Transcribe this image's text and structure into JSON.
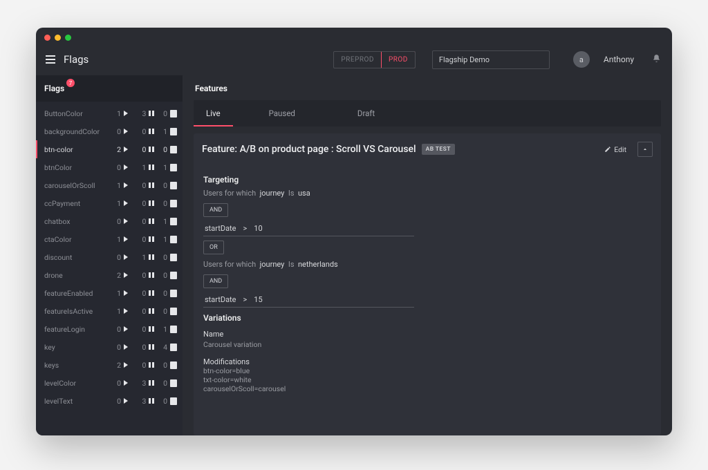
{
  "header": {
    "app_title": "Flags",
    "env_a": "PREPROD",
    "env_b": "PROD",
    "project": "Flagship Demo",
    "avatar_initial": "a",
    "username": "Anthony"
  },
  "sidebar": {
    "title": "Flags",
    "badge": "7",
    "items": [
      {
        "name": "ButtonColor",
        "live": 1,
        "paused": 3,
        "draft": 0,
        "active": false
      },
      {
        "name": "backgroundColor",
        "live": 0,
        "paused": 0,
        "draft": 1,
        "active": false
      },
      {
        "name": "btn-color",
        "live": 2,
        "paused": 0,
        "draft": 0,
        "active": true
      },
      {
        "name": "btnColor",
        "live": 0,
        "paused": 1,
        "draft": 1,
        "active": false
      },
      {
        "name": "carouselOrScoll",
        "live": 1,
        "paused": 0,
        "draft": 0,
        "active": false
      },
      {
        "name": "ccPayment",
        "live": 1,
        "paused": 0,
        "draft": 0,
        "active": false
      },
      {
        "name": "chatbox",
        "live": 0,
        "paused": 0,
        "draft": 1,
        "active": false
      },
      {
        "name": "ctaColor",
        "live": 1,
        "paused": 0,
        "draft": 1,
        "active": false
      },
      {
        "name": "discount",
        "live": 0,
        "paused": 1,
        "draft": 0,
        "active": false
      },
      {
        "name": "drone",
        "live": 2,
        "paused": 0,
        "draft": 0,
        "active": false
      },
      {
        "name": "featureEnabled",
        "live": 1,
        "paused": 0,
        "draft": 0,
        "active": false
      },
      {
        "name": "featureIsActive",
        "live": 1,
        "paused": 0,
        "draft": 0,
        "active": false
      },
      {
        "name": "featureLogin",
        "live": 0,
        "paused": 0,
        "draft": 1,
        "active": false
      },
      {
        "name": "key",
        "live": 0,
        "paused": 0,
        "draft": 4,
        "active": false
      },
      {
        "name": "keys",
        "live": 2,
        "paused": 0,
        "draft": 0,
        "active": false
      },
      {
        "name": "levelColor",
        "live": 0,
        "paused": 3,
        "draft": 0,
        "active": false
      },
      {
        "name": "levelText",
        "live": 0,
        "paused": 3,
        "draft": 0,
        "active": false
      }
    ]
  },
  "main": {
    "section": "Features",
    "tabs": {
      "live": "Live",
      "paused": "Paused",
      "draft": "Draft"
    },
    "feature_prefix": "Feature: ",
    "feature_title": "A/B on product page : Scroll VS Carousel",
    "chip": "AB TEST",
    "edit": "Edit",
    "targeting_h": "Targeting",
    "users_prefix": "Users for which",
    "attr": "journey",
    "is": "Is",
    "val1": "usa",
    "and": "AND",
    "cond_attr": "startDate",
    "cond_op": ">",
    "cond_v1": "10",
    "or": "OR",
    "val2": "netherlands",
    "cond_v2": "15",
    "variations_h": "Variations",
    "var_name_label": "Name",
    "var_name": "Carousel variation",
    "mods_label": "Modifications",
    "mods": [
      "btn-color=blue",
      "txt-color=white",
      "carouselOrScoll=carousel"
    ]
  }
}
